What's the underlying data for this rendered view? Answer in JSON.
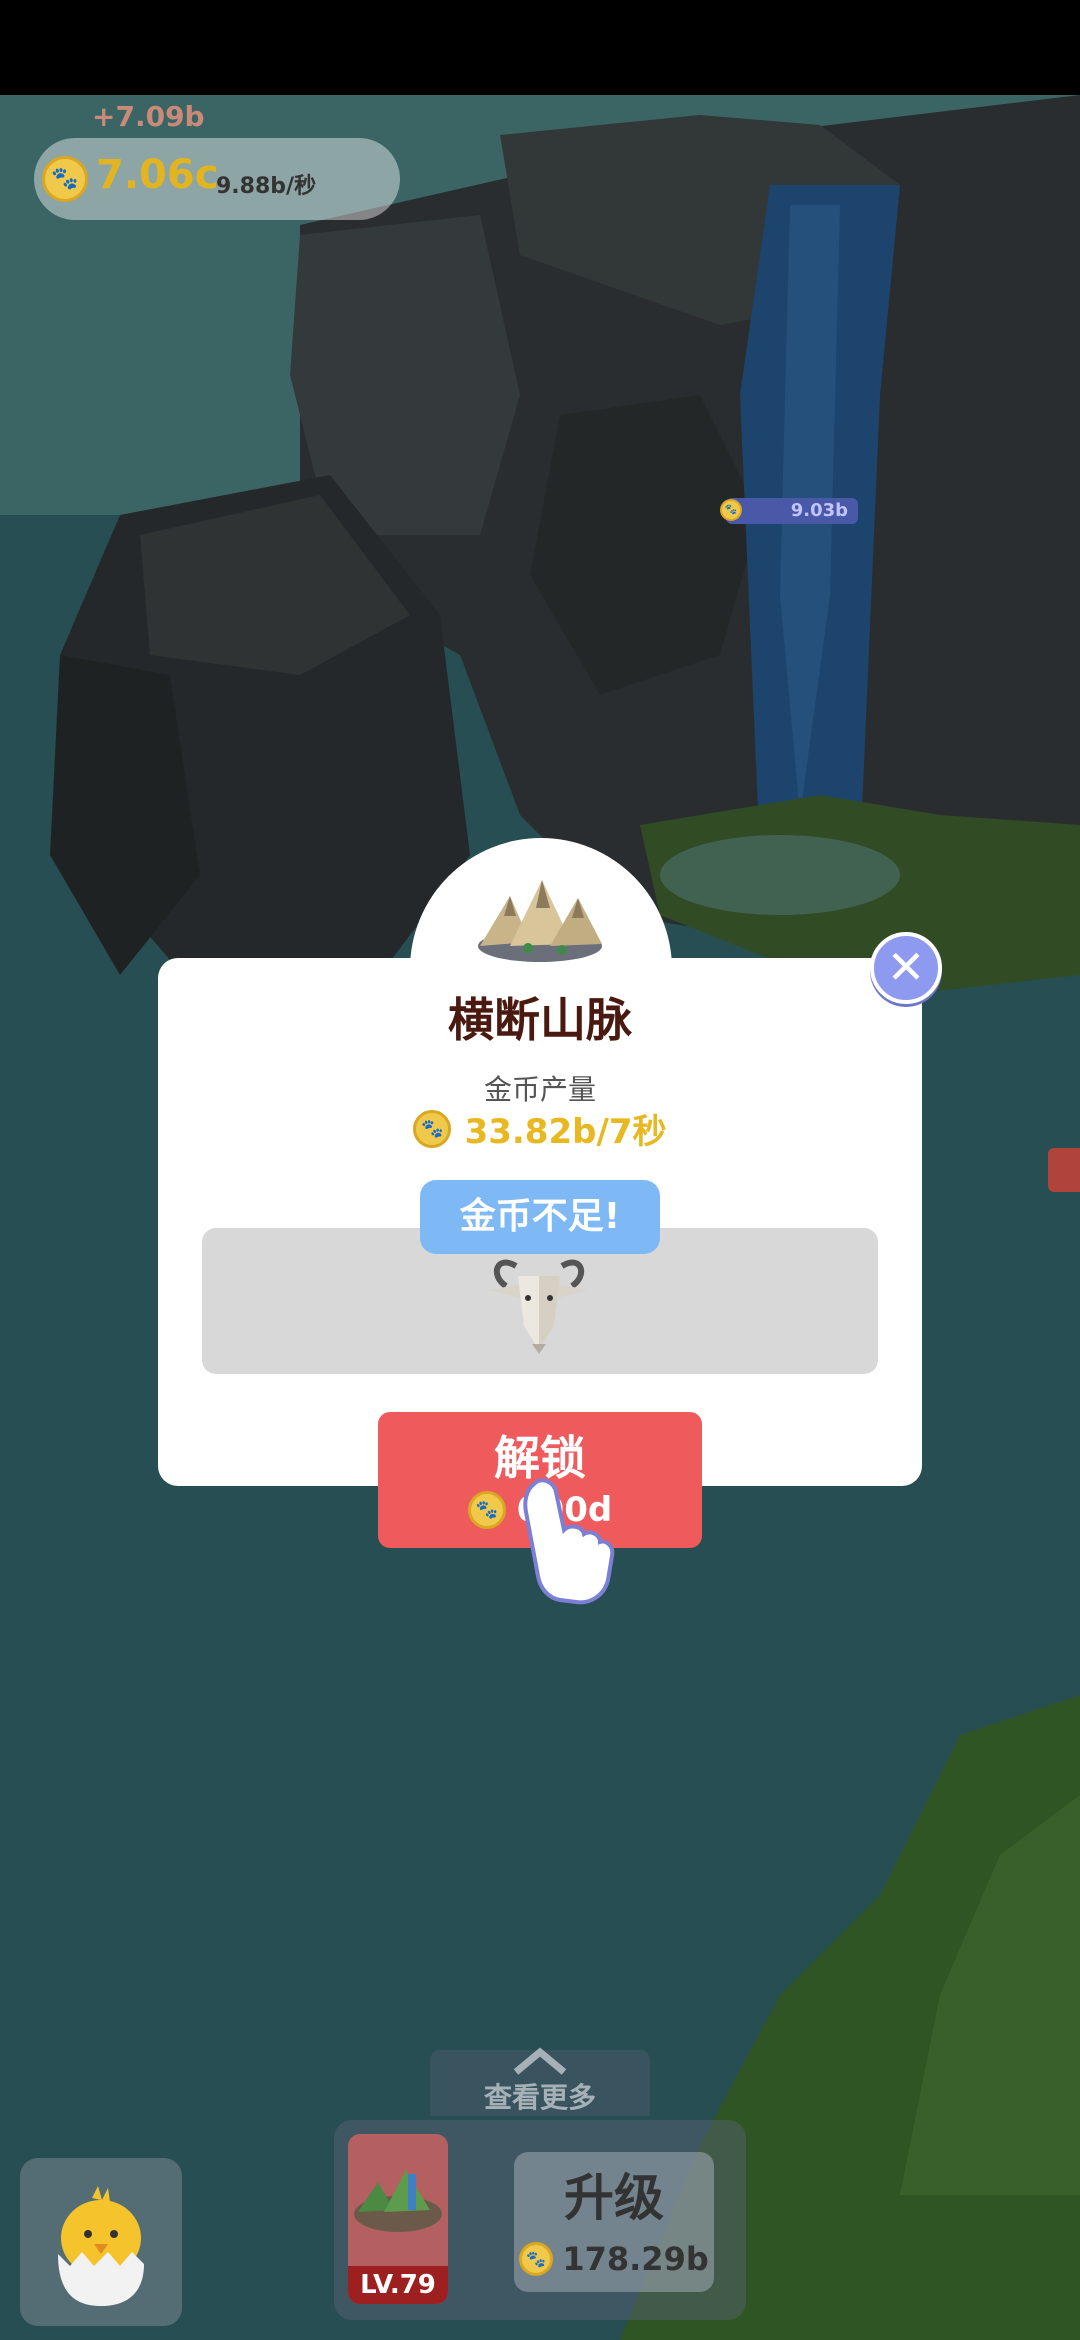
{
  "hud": {
    "income_delta": "+7.09b",
    "coin_total": "7.06c",
    "coin_rate": "9.88b/秒",
    "waterfall_label": "9.03b"
  },
  "modal": {
    "title": "横断山脉",
    "yield_label": "金币产量",
    "yield_value": "33.82b/7秒",
    "toast": "金币不足!",
    "unlock_label": "解锁",
    "unlock_price": "000d",
    "close_symbol": "✕"
  },
  "bottom": {
    "see_more": "查看更多",
    "level": "LV.79",
    "upgrade_label": "升级",
    "upgrade_price": "178.29b"
  },
  "colors": {
    "coin_gold": "#e2b520",
    "unlock_red": "#ef5a5c",
    "toast_blue": "#7fb9f5",
    "close_purple": "#8e9af0",
    "title_brown": "#4a1a10"
  }
}
